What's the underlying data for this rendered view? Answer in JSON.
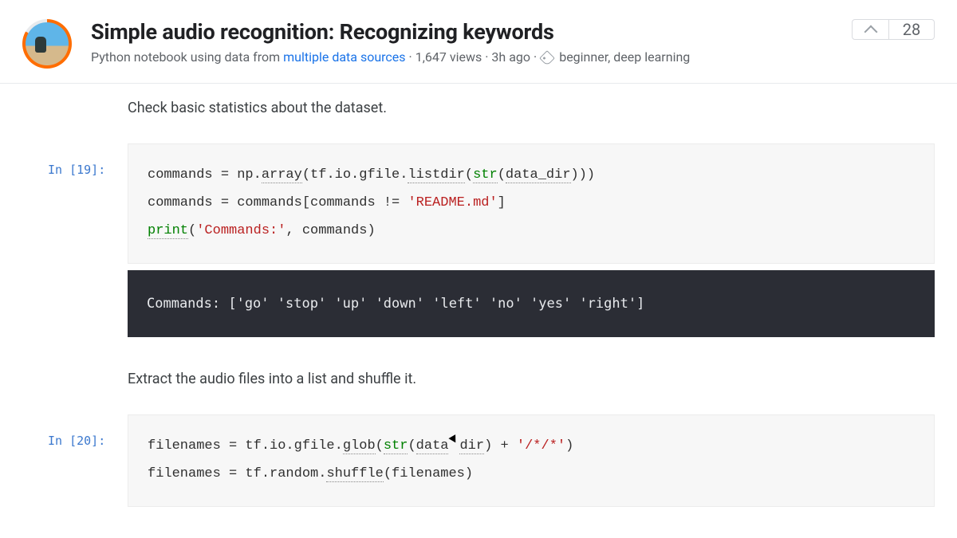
{
  "header": {
    "title": "Simple audio recognition: Recognizing keywords",
    "meta_prefix": "Python notebook using data from ",
    "meta_link": "multiple data sources",
    "meta_views": "1,647 views",
    "meta_time": "3h ago",
    "tags": "beginner, deep learning",
    "vote_count": "28"
  },
  "prose": {
    "p1": "Check basic statistics about the dataset.",
    "p2": "Extract the audio files into a list and shuffle it."
  },
  "cells": {
    "c19": {
      "prompt": "In [19]:",
      "code": {
        "l1a": "commands = np.",
        "l1b": "array",
        "l1c": "(tf.io.gfile.",
        "l1d": "listdir",
        "l1e": "(",
        "l1f": "str",
        "l1g": "(",
        "l1h": "data_dir",
        "l1i": ")))",
        "l2a": "commands = commands[commands != ",
        "l2b": "'README.md'",
        "l2c": "]",
        "l3a": "print",
        "l3b": "(",
        "l3c": "'Commands:'",
        "l3d": ", commands)"
      },
      "output": "Commands: ['go' 'stop' 'up' 'down' 'left' 'no' 'yes' 'right']"
    },
    "c20": {
      "prompt": "In [20]:",
      "code": {
        "l1a": "filenames = tf.io.gfile.",
        "l1b": "glob",
        "l1c": "(",
        "l1d": "str",
        "l1e": "(",
        "l1f": "data",
        "l1g": "dir",
        "l1h": ") + ",
        "l1i": "'/*/*'",
        "l1j": ")",
        "l2a": "filenames = tf.random.",
        "l2b": "shuffle",
        "l2c": "(filenames)"
      }
    }
  }
}
